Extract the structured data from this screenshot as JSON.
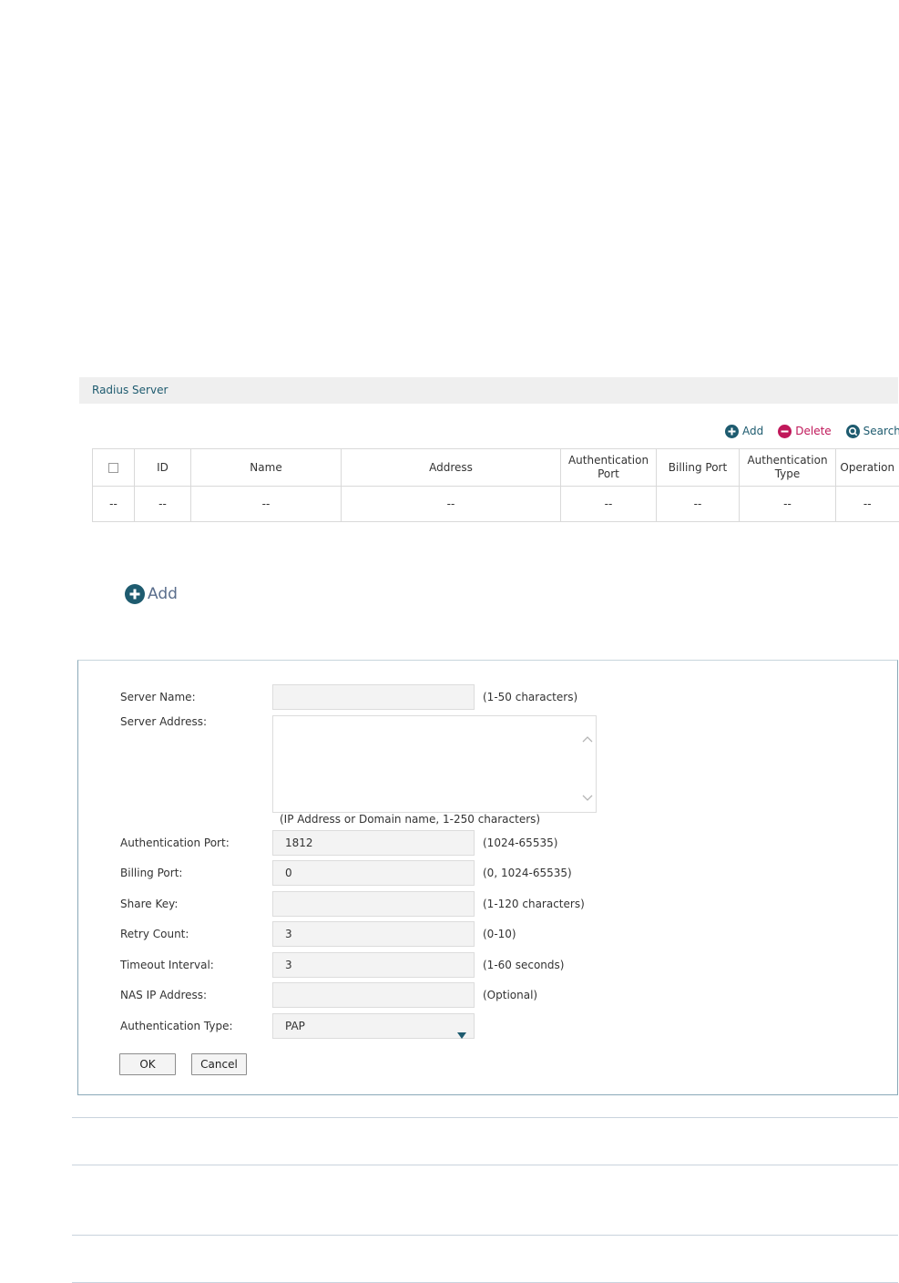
{
  "panel": {
    "title": "Radius Server"
  },
  "toolbar": {
    "add_label": "Add",
    "delete_label": "Delete",
    "search_label": "Search",
    "add_color": "#1e5b6f",
    "delete_color": "#c0185a",
    "search_color": "#1e5b6f"
  },
  "table": {
    "headers": [
      "ID",
      "Name",
      "Address",
      "Authentication Port",
      "Billing Port",
      "Authentication Type",
      "Operation"
    ],
    "row": [
      "--",
      "--",
      "--",
      "--",
      "--",
      "--",
      "--",
      "--"
    ]
  },
  "add_section": {
    "label": "Add",
    "icon": "plus-circle-icon"
  },
  "form": {
    "server_name": {
      "label": "Server Name:",
      "value": "",
      "hint": "(1-50 characters)"
    },
    "server_address": {
      "label": "Server Address:",
      "value": "",
      "hint": "(IP Address or Domain name, 1-250 characters)"
    },
    "auth_port": {
      "label": "Authentication Port:",
      "value": "1812",
      "hint": "(1024-65535)"
    },
    "billing_port": {
      "label": "Billing Port:",
      "value": "0",
      "hint": "(0, 1024-65535)"
    },
    "share_key": {
      "label": "Share Key:",
      "value": "",
      "hint": "(1-120 characters)"
    },
    "retry_count": {
      "label": "Retry Count:",
      "value": "3",
      "hint": "(0-10)"
    },
    "timeout": {
      "label": "Timeout Interval:",
      "value": "3",
      "hint": "(1-60 seconds)"
    },
    "nas_ip": {
      "label": "NAS IP Address:",
      "value": "",
      "hint": "(Optional)"
    },
    "auth_type": {
      "label": "Authentication Type:",
      "value": "PAP"
    },
    "ok_label": "OK",
    "cancel_label": "Cancel"
  }
}
